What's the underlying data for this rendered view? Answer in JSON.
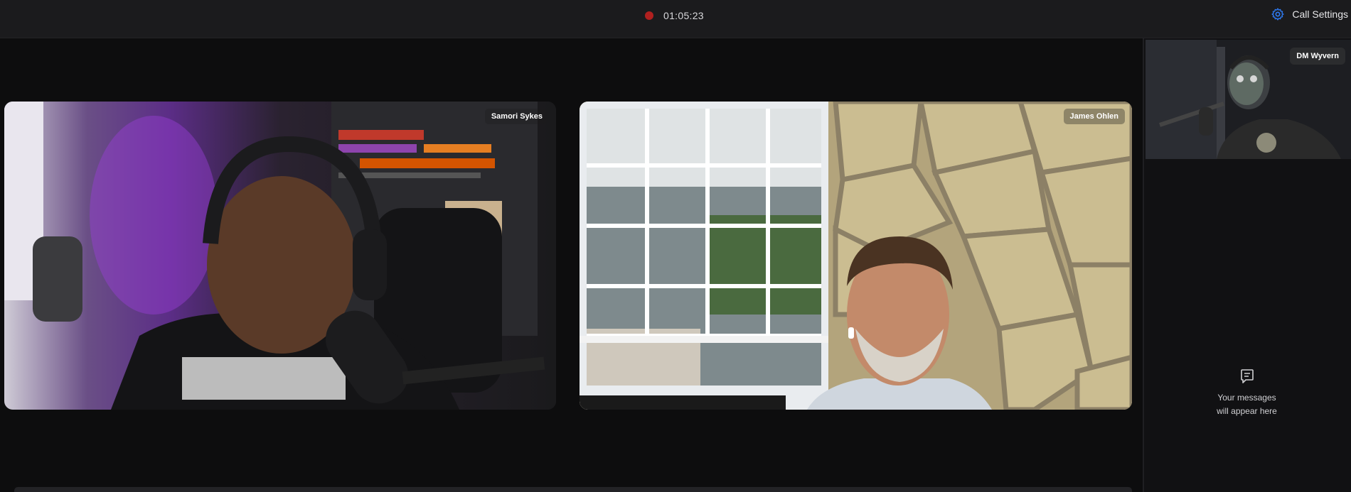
{
  "recording": {
    "time": "01:05:23"
  },
  "header": {
    "call_settings_label": "Call Settings"
  },
  "participants": [
    {
      "name": "Samori Sykes"
    },
    {
      "name": "James Ohlen"
    }
  ],
  "self_view": {
    "name": "DM Wyvern"
  },
  "chat": {
    "empty_line1": "Your messages",
    "empty_line2": "will appear here"
  },
  "colors": {
    "accent": "#2f7cf6",
    "record": "#b0201f",
    "background": "#0d0d0e",
    "topbar": "#1b1b1d"
  }
}
